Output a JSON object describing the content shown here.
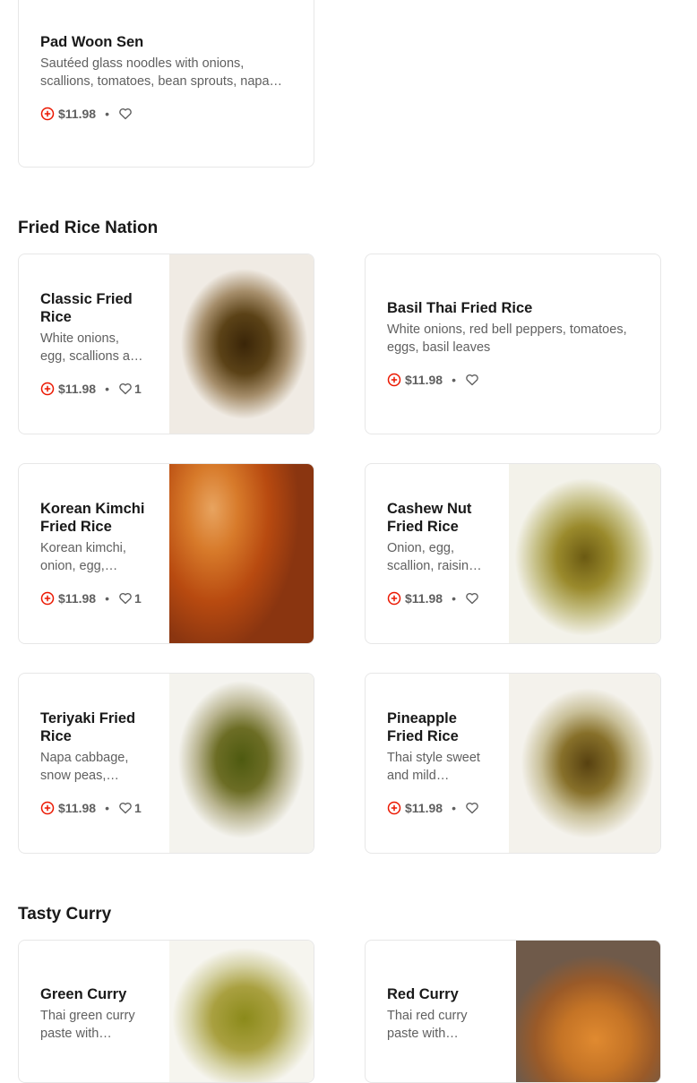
{
  "colors": {
    "accent": "#eb1700",
    "text": "#191919",
    "muted": "#606060",
    "border": "#e7e7e7"
  },
  "sections": [
    {
      "title": "Fried Rice Nation",
      "items": []
    },
    {
      "title": "Tasty Curry",
      "items": []
    }
  ],
  "top_item": {
    "name": "Pad Woon Sen",
    "description": "Sautéed glass noodles with onions, scallions, tomatoes, bean sprouts, napa cabbage",
    "price": "$11.98"
  },
  "items": {
    "classic": {
      "name": "Classic Fried Rice",
      "description": "White onions, egg, scallions and peas",
      "price": "$11.98",
      "likes": "1"
    },
    "basil": {
      "name": "Basil Thai Fried Rice",
      "description": "White onions, red bell peppers, tomatoes, eggs, basil leaves",
      "price": "$11.98"
    },
    "kimchi": {
      "name": "Korean Kimchi Fried Rice",
      "description": "Korean kimchi, onion, egg, scallions",
      "price": "$11.98",
      "likes": "1"
    },
    "cashew": {
      "name": "Cashew Nut Fried Rice",
      "description": "Onion, egg, scallion, raisins, cashew nuts",
      "price": "$11.98"
    },
    "teriyaki": {
      "name": "Teriyaki Fried Rice",
      "description": "Napa cabbage, snow peas, carrots, onions",
      "price": "$11.98",
      "likes": "1"
    },
    "pineapple": {
      "name": "Pineapple Fried Rice",
      "description": "Thai style sweet and mild pineapple fried rice",
      "price": "$11.98"
    },
    "green_curry": {
      "name": "Green Curry",
      "description": "Thai green curry paste with coconut milk"
    },
    "red_curry": {
      "name": "Red Curry",
      "description": "Thai red curry paste with coconut milk"
    }
  },
  "separator": "•",
  "icons": {
    "add": "add-circle-icon",
    "like": "heart-icon"
  }
}
